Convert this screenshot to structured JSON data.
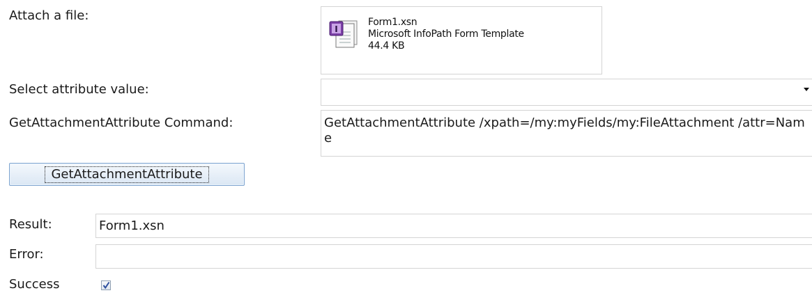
{
  "attach": {
    "label": "Attach a file:",
    "file_name": "Form1.xsn",
    "file_type": "Microsoft InfoPath Form Template",
    "file_size": "44.4 KB",
    "icon": "infopath-file-icon"
  },
  "attribute": {
    "label": "Select attribute value:",
    "selected": ""
  },
  "command": {
    "label": "GetAttachmentAttribute Command:",
    "value": "GetAttachmentAttribute /xpath=/my:myFields/my:FileAttachment /attr=Name"
  },
  "button": {
    "label": "GetAttachmentAttribute"
  },
  "result": {
    "label": "Result:",
    "value": "Form1.xsn"
  },
  "error": {
    "label": "Error:",
    "value": ""
  },
  "success": {
    "label": "Success",
    "checked": true
  }
}
